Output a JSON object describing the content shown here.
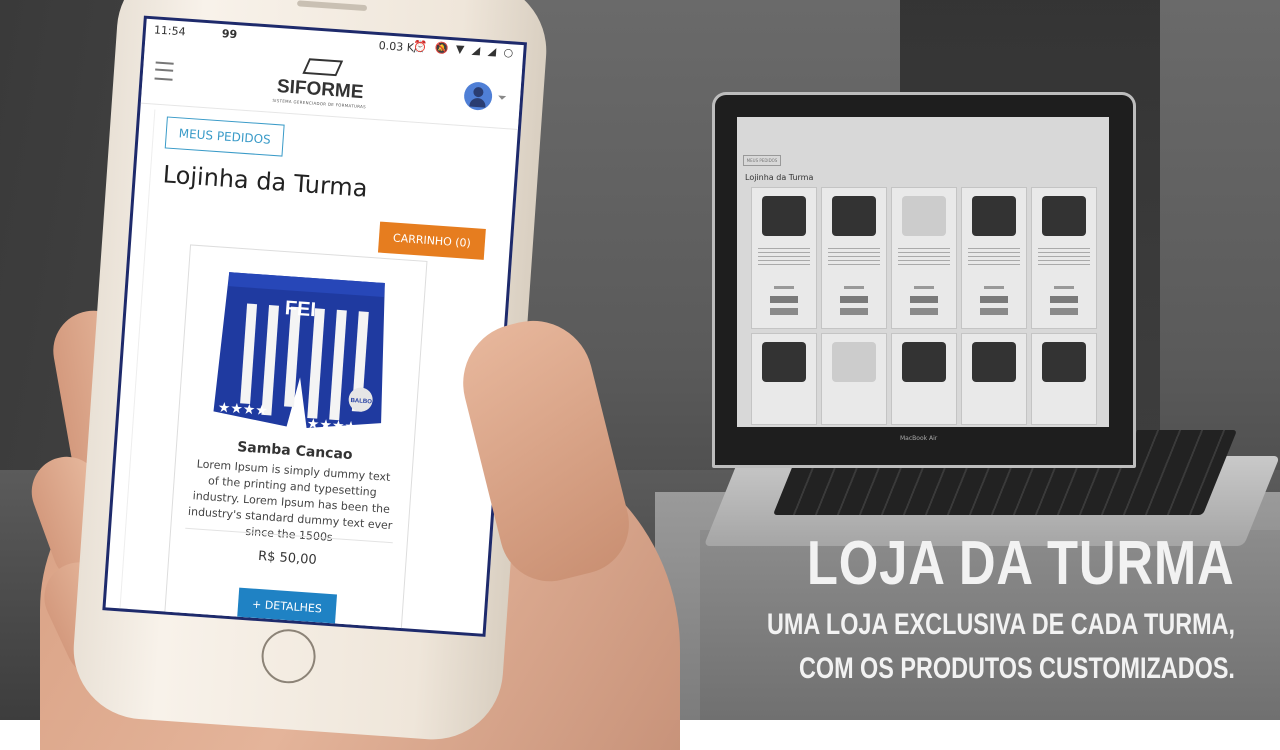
{
  "phone": {
    "status": {
      "time": "11:54",
      "signal_label": "99",
      "speed": "0.03 K/s",
      "icons": "⏰ 🔕 ▼ ◢ ◢ ○"
    },
    "app": {
      "logo_name": "SIFORME",
      "logo_tagline": "SISTEMA GERENCIADOR DE FORMATURAS"
    },
    "orders_button": "MEUS PEDIDOS",
    "page_title": "Lojinha da Turma",
    "cart_button": "CARRINHO (0)",
    "product": {
      "name": "Samba Cancao",
      "description": "Lorem Ipsum is simply dummy text of the printing and typesetting industry. Lorem Ipsum has been the industry's standard dummy text ever since the 1500s",
      "price": "R$ 50,00",
      "details_button": "+ DETALHES",
      "print_text": "FEI",
      "badge_text": "BALBOA"
    }
  },
  "laptop": {
    "page_button": "MEUS PEDIDOS",
    "page_title": "Lojinha da Turma",
    "brand": "MacBook Air"
  },
  "caption": {
    "title": "LOJA DA TURMA",
    "line1": "UMA LOJA EXCLUSIVA DE CADA TURMA,",
    "line2": "COM OS PRODUTOS CUSTOMIZADOS."
  },
  "colors": {
    "orders_accent": "#3a9bc8",
    "cart_orange": "#e67d1f",
    "details_blue": "#1f82c4",
    "shorts_blue": "#1f3aa0"
  }
}
